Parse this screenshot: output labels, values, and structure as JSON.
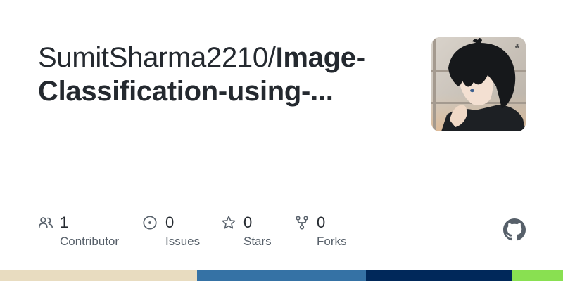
{
  "repo": {
    "owner": "SumitSharma2210/",
    "name": "Image-Classification-using-..."
  },
  "avatar": {
    "alt": "avatar"
  },
  "stats": [
    {
      "icon": "people-icon",
      "value": "1",
      "label": "Contributor"
    },
    {
      "icon": "issue-opened-icon",
      "value": "0",
      "label": "Issues"
    },
    {
      "icon": "star-icon",
      "value": "0",
      "label": "Stars"
    },
    {
      "icon": "repo-forked-icon",
      "value": "0",
      "label": "Forks"
    }
  ],
  "brand_icon": "github-mark-icon",
  "language_bar": [
    {
      "color": "#e8dcc0",
      "fraction": 0.35
    },
    {
      "color": "#3572a5",
      "fraction": 0.3
    },
    {
      "color": "#00285a",
      "fraction": 0.26
    },
    {
      "color": "#89e051",
      "fraction": 0.09
    }
  ],
  "colors": {
    "text": "#24292f",
    "muted": "#57606a",
    "icon": "#57606a"
  }
}
